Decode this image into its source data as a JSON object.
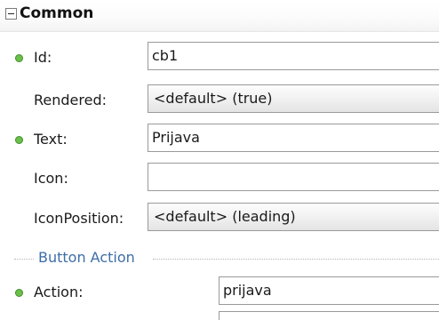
{
  "section": {
    "title": "Common",
    "toggle_icon": "collapse-minus-icon"
  },
  "properties": {
    "id": {
      "label": "Id:",
      "value": "cb1",
      "required": true
    },
    "rendered": {
      "label": "Rendered:",
      "value": "<default> (true)"
    },
    "text": {
      "label": "Text:",
      "value": "Prijava",
      "required": true
    },
    "icon": {
      "label": "Icon:",
      "value": ""
    },
    "icon_position": {
      "label": "IconPosition:",
      "value": "<default> (leading)"
    }
  },
  "button_action": {
    "title": "Button Action",
    "action": {
      "label": "Action:",
      "value": "prijava",
      "required": true
    }
  },
  "colors": {
    "required_dot": "#6cc04a",
    "group_title": "#3d6ea8"
  }
}
